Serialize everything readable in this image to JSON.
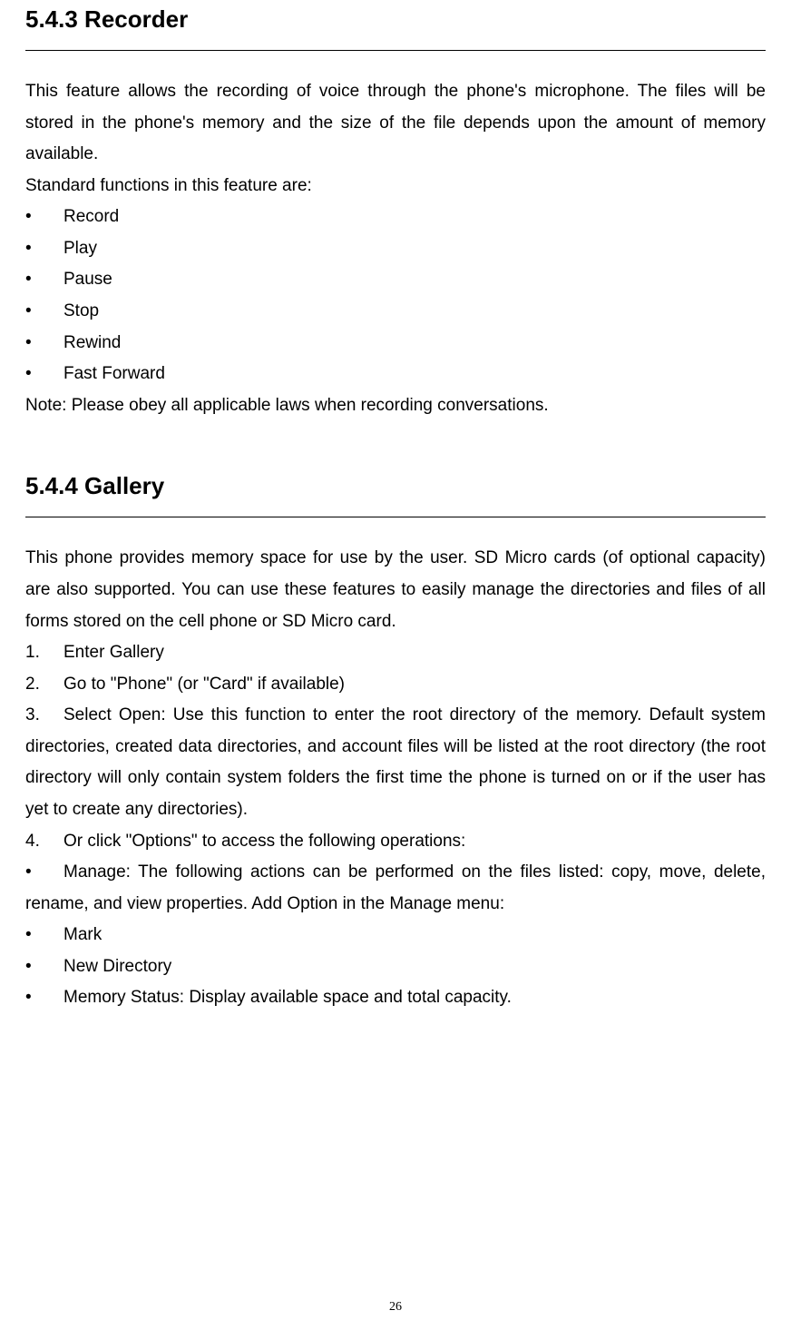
{
  "section1": {
    "heading": "5.4.3 Recorder",
    "para1": "This feature allows the recording of voice through the phone's microphone.    The files will be stored in the phone's memory and the size of the file depends upon the amount of memory available.",
    "intro": "Standard functions in this feature are:",
    "bullets": [
      "Record",
      "Play",
      "Pause",
      "Stop",
      "Rewind",
      "Fast Forward"
    ],
    "note": "Note: Please obey all applicable laws when recording conversations."
  },
  "section2": {
    "heading": "5.4.4 Gallery",
    "para1": "This phone provides memory space for use by the user. SD Micro cards (of optional capacity) are also supported. You can use these features to easily manage the directories and files of all forms stored on the cell phone or SD Micro card.",
    "step1": "Enter Gallery",
    "step2": "Go to \"Phone\" (or \"Card\" if available)",
    "step3": "Select Open: Use this function to enter the root directory of the memory. Default system directories, created data directories, and account files will be listed at the root directory (the root directory will only contain system folders the first time the phone is turned on or if the user has yet to create any directories).",
    "step4": "Or click \"Options\" to access the following operations:",
    "manage": "Manage: The following actions can be performed on the files listed: copy, move, delete, rename, and view properties.      Add    Option in the Manage menu:",
    "bullets2": [
      "Mark",
      "New Directory",
      "Memory Status: Display available space and total capacity."
    ]
  },
  "pageNumber": "26"
}
